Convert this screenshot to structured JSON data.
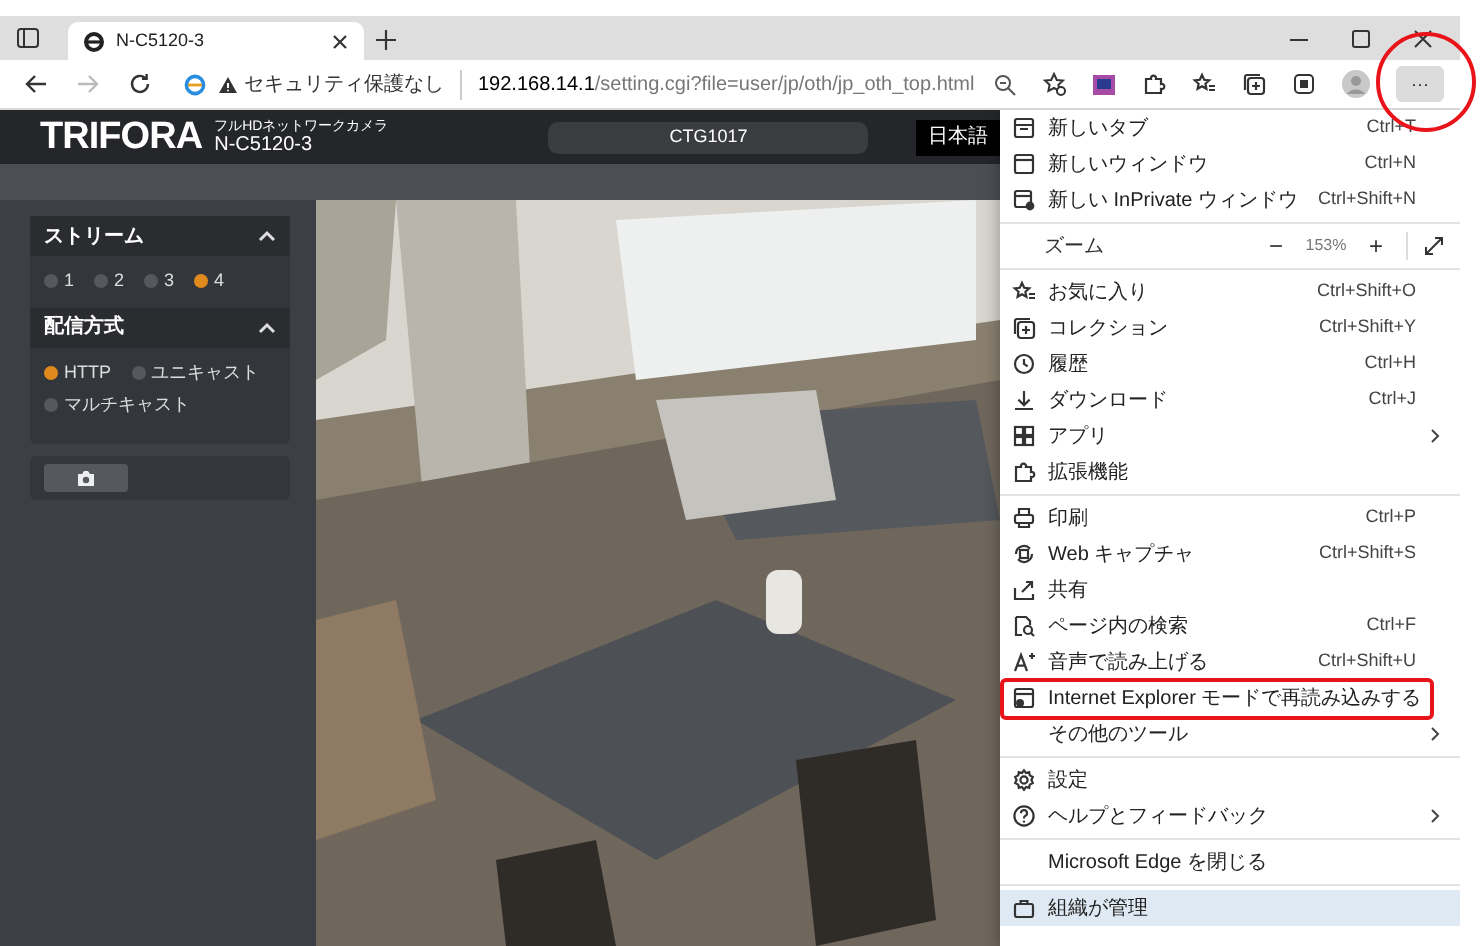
{
  "browser": {
    "tab": {
      "title": "N-C5120-3"
    },
    "address": {
      "security": "セキュリティ保護なし",
      "host": "192.168.14.1",
      "path": "/setting.cgi?file=user/jp/oth/jp_oth_top.html"
    },
    "more_button": {
      "label": "···"
    }
  },
  "camera_page": {
    "brand": "TRIFORA",
    "subtitle": "フルHDネットワークカメラ",
    "model": "N-C5120-3",
    "camera_name": "CTG1017",
    "language": "日本語",
    "panels": [
      {
        "title": "ストリーム",
        "expanded": true,
        "options": [
          {
            "label": "1",
            "selected": false
          },
          {
            "label": "2",
            "selected": false
          },
          {
            "label": "3",
            "selected": false
          },
          {
            "label": "4",
            "selected": true
          }
        ]
      },
      {
        "title": "配信方式",
        "expanded": true,
        "options": [
          {
            "label": "HTTP",
            "selected": true
          },
          {
            "label": "ユニキャスト",
            "selected": false
          },
          {
            "label": "マルチキャスト",
            "selected": false
          }
        ]
      }
    ]
  },
  "menu": {
    "sections": [
      [
        {
          "kind": "command",
          "label": "新しいタブ",
          "shortcut": "Ctrl+T",
          "submenu": false,
          "annotated": false
        },
        {
          "kind": "command",
          "label": "新しいウィンドウ",
          "shortcut": "Ctrl+N",
          "submenu": false,
          "annotated": false
        },
        {
          "kind": "command",
          "label": "新しい InPrivate ウィンドウ",
          "shortcut": "Ctrl+Shift+N",
          "submenu": false,
          "annotated": false
        }
      ],
      [
        {
          "kind": "zoom",
          "label": "ズーム",
          "value": "153%",
          "minus": "−",
          "plus": "+"
        }
      ],
      [
        {
          "kind": "command",
          "label": "お気に入り",
          "shortcut": "Ctrl+Shift+O",
          "submenu": false,
          "annotated": false
        },
        {
          "kind": "command",
          "label": "コレクション",
          "shortcut": "Ctrl+Shift+Y",
          "submenu": false,
          "annotated": false
        },
        {
          "kind": "command",
          "label": "履歴",
          "shortcut": "Ctrl+H",
          "submenu": false,
          "annotated": false
        },
        {
          "kind": "command",
          "label": "ダウンロード",
          "shortcut": "Ctrl+J",
          "submenu": false,
          "annotated": false
        },
        {
          "kind": "command",
          "label": "アプリ",
          "submenu": true,
          "annotated": false
        },
        {
          "kind": "command",
          "label": "拡張機能",
          "submenu": false,
          "annotated": false
        }
      ],
      [
        {
          "kind": "command",
          "label": "印刷",
          "shortcut": "Ctrl+P",
          "submenu": false,
          "annotated": false
        },
        {
          "kind": "command",
          "label": "Web キャプチャ",
          "shortcut": "Ctrl+Shift+S",
          "submenu": false,
          "annotated": false
        },
        {
          "kind": "command",
          "label": "共有",
          "submenu": false,
          "annotated": false
        },
        {
          "kind": "command",
          "label": "ページ内の検索",
          "shortcut": "Ctrl+F",
          "submenu": false,
          "annotated": false
        },
        {
          "kind": "command",
          "label": "音声で読み上げる",
          "shortcut": "Ctrl+Shift+U",
          "submenu": false,
          "annotated": false
        },
        {
          "kind": "command",
          "label": "Internet Explorer モードで再読み込みする",
          "submenu": false,
          "annotated": true
        },
        {
          "kind": "command",
          "label": "その他のツール",
          "submenu": true,
          "annotated": false
        }
      ],
      [
        {
          "kind": "command",
          "label": "設定",
          "submenu": false,
          "annotated": false
        },
        {
          "kind": "command",
          "label": "ヘルプとフィードバック",
          "submenu": true,
          "annotated": false
        }
      ],
      [
        {
          "kind": "command",
          "label": "Microsoft Edge を閉じる",
          "submenu": false,
          "annotated": false
        }
      ],
      [
        {
          "kind": "managed",
          "label": "組織が管理"
        }
      ]
    ]
  }
}
